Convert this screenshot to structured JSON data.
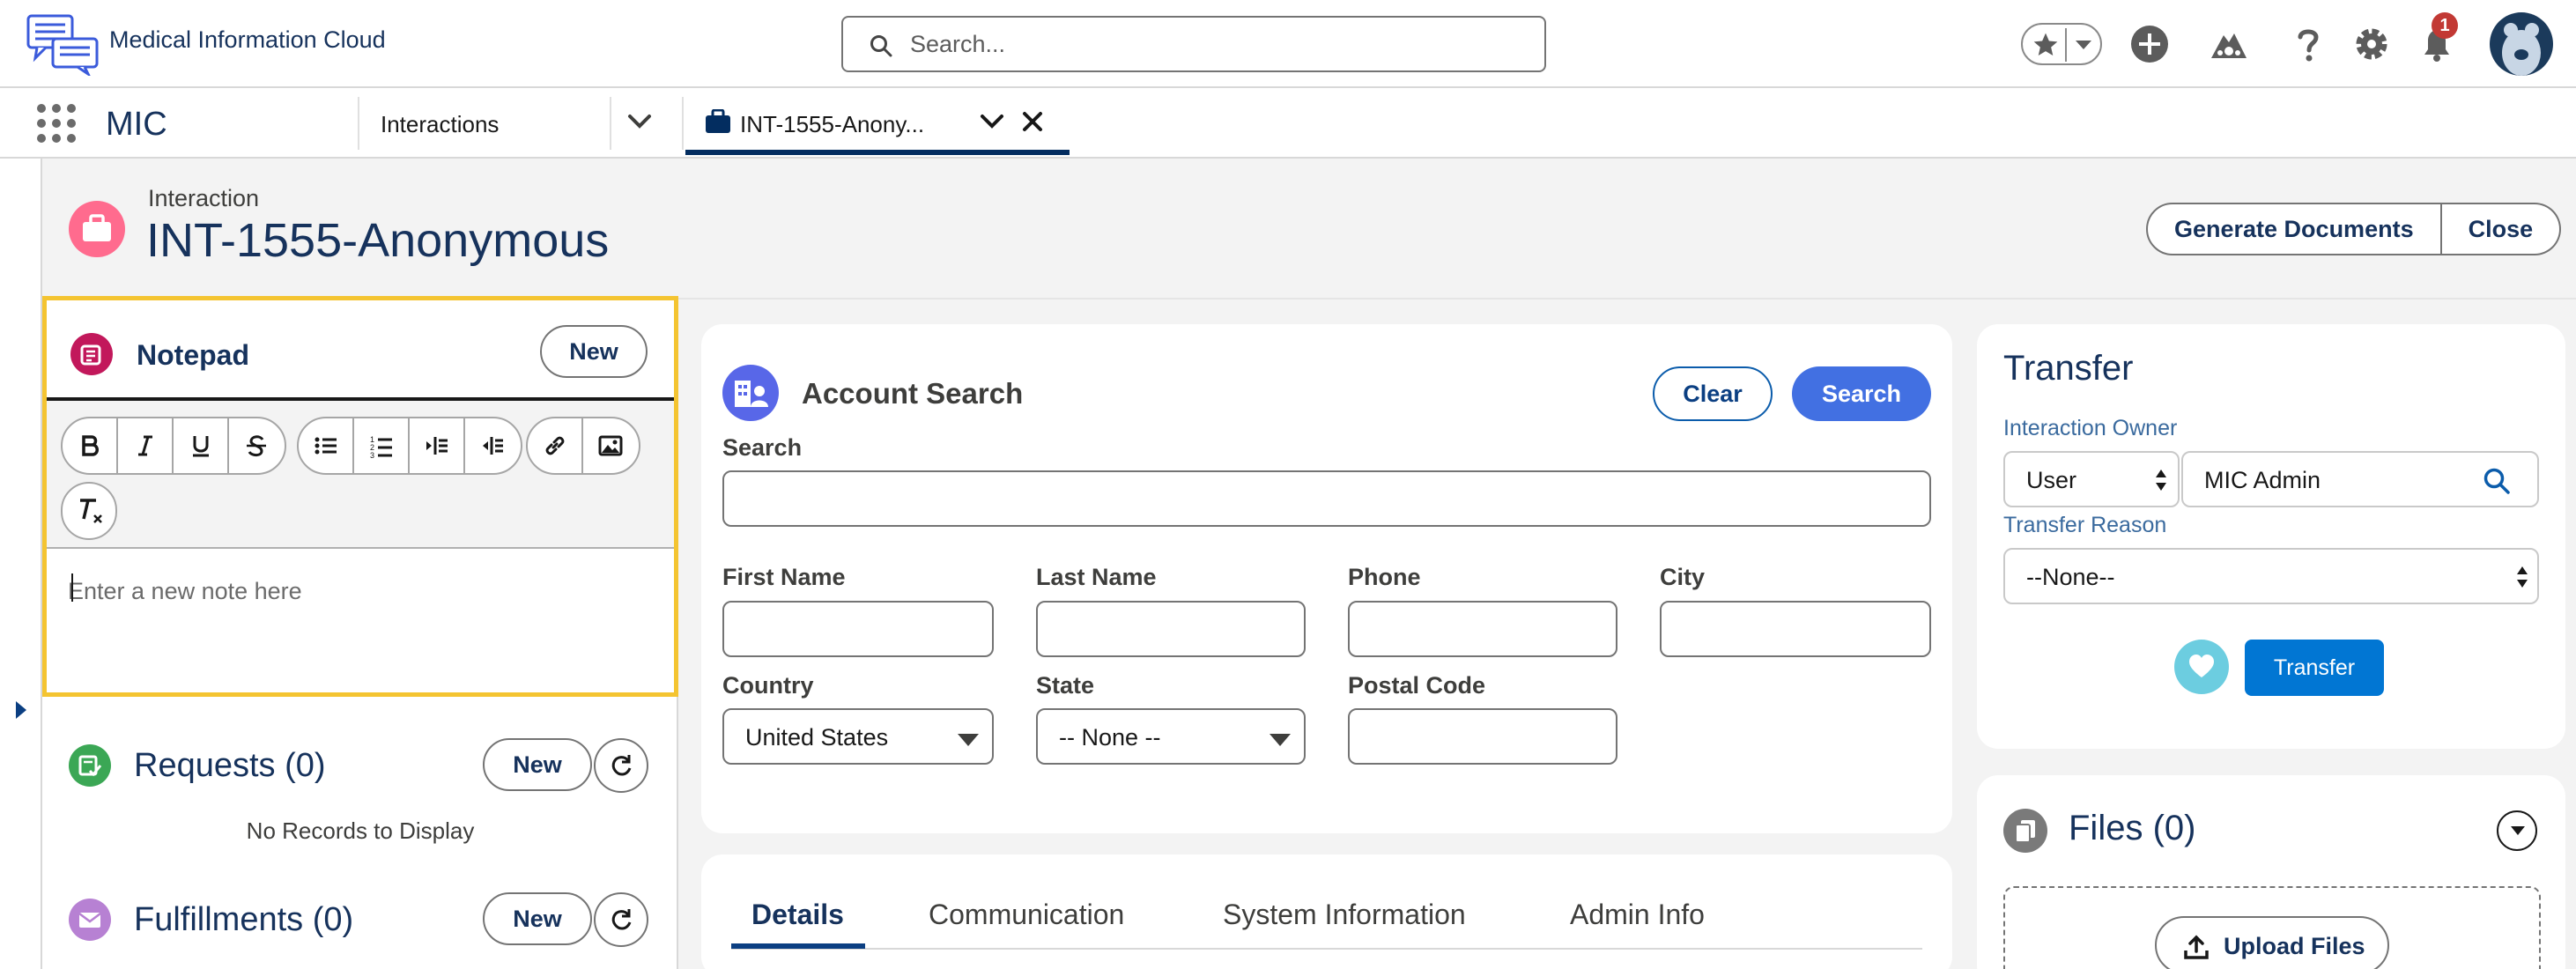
{
  "header": {
    "app_name": "Medical Information Cloud",
    "search_placeholder": "Search...",
    "notification_count": "1",
    "icons": [
      "chat-logo-icon",
      "search-icon",
      "star-icon",
      "chevron-down-icon",
      "plus-icon",
      "trailhead-icon",
      "help-icon",
      "gear-icon",
      "bell-icon",
      "avatar"
    ]
  },
  "nav": {
    "app_name": "MIC",
    "items": [
      {
        "label": "Interactions"
      }
    ],
    "workspace_tab": {
      "label": "INT-1555-Anony..."
    }
  },
  "record": {
    "object_label": "Interaction",
    "title": "INT-1555-Anonymous",
    "actions": [
      "Generate Documents",
      "Close"
    ]
  },
  "notepad": {
    "title": "Notepad",
    "new_label": "New",
    "placeholder": "Enter a new note here",
    "toolbar": [
      "bold",
      "italic",
      "underline",
      "strikethrough",
      "bulleted-list",
      "numbered-list",
      "indent",
      "outdent",
      "link",
      "image",
      "remove-formatting"
    ]
  },
  "requests": {
    "title": "Requests (0)",
    "new_label": "New",
    "empty_text": "No Records to Display"
  },
  "fulfillments": {
    "title": "Fulfillments (0)",
    "new_label": "New"
  },
  "account_search": {
    "title": "Account Search",
    "clear_label": "Clear",
    "search_label": "Search",
    "fields": {
      "search": "Search",
      "first_name": "First Name",
      "last_name": "Last Name",
      "phone": "Phone",
      "city": "City",
      "country": "Country",
      "country_value": "United States",
      "state": "State",
      "state_value": "-- None --",
      "postal_code": "Postal Code"
    }
  },
  "detail_tabs": [
    "Details",
    "Communication",
    "System Information",
    "Admin Info"
  ],
  "transfer": {
    "title": "Transfer",
    "owner_label": "Interaction Owner",
    "owner_type": "User",
    "owner_value": "MIC Admin",
    "reason_label": "Transfer Reason",
    "reason_value": "--None--",
    "button_label": "Transfer"
  },
  "files": {
    "title": "Files (0)",
    "upload_label": "Upload Files"
  },
  "colors": {
    "brand": "#4270e2",
    "navy_text": "#16325c",
    "notepad_focus": "#f4c431",
    "transfer_button": "#0176d3"
  }
}
